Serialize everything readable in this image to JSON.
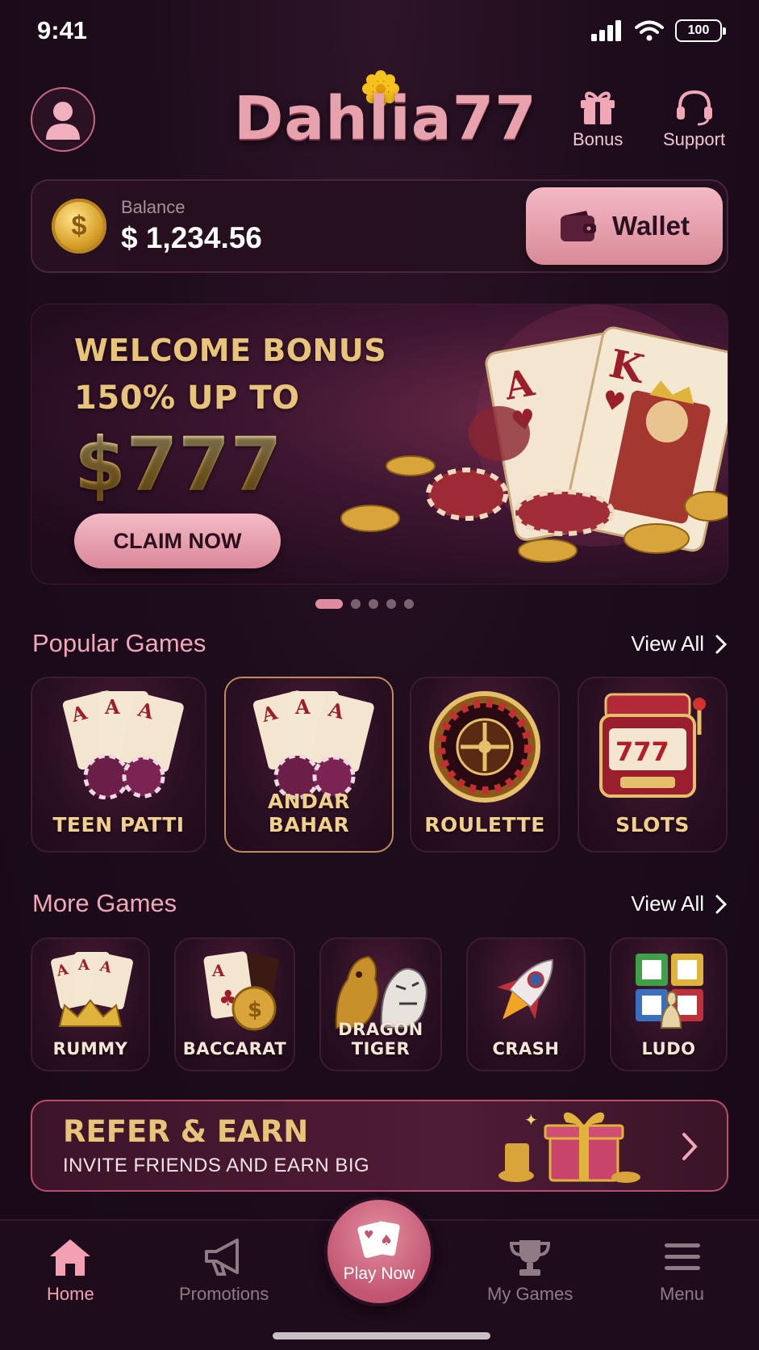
{
  "status": {
    "time": "9:41",
    "battery": "100"
  },
  "header": {
    "brand": "Dahlia77",
    "bonus_label": "Bonus",
    "support_label": "Support"
  },
  "balance": {
    "label": "Balance",
    "value": "$ 1,234.56",
    "wallet_label": "Wallet"
  },
  "banner": {
    "line1": "WELCOME BONUS",
    "line2": "150% UP TO",
    "amount": "$777",
    "cta": "CLAIM NOW",
    "slide_count": 5,
    "active_slide": 1
  },
  "popular": {
    "title": "Popular Games",
    "view_all": "View All",
    "games": [
      {
        "label": "TEEN PATTI",
        "icon": "cards-chips-icon"
      },
      {
        "label": "ANDAR BAHAR",
        "icon": "cards-chips-icon"
      },
      {
        "label": "ROULETTE",
        "icon": "roulette-wheel-icon"
      },
      {
        "label": "SLOTS",
        "icon": "slot-machine-icon"
      }
    ]
  },
  "more": {
    "title": "More Games",
    "view_all": "View All",
    "games": [
      {
        "label": "RUMMY",
        "icon": "cards-crown-icon"
      },
      {
        "label": "BACCARAT",
        "icon": "card-coin-icon"
      },
      {
        "label": "DRAGON TIGER",
        "icon": "dragon-tiger-icon"
      },
      {
        "label": "CRASH",
        "icon": "rocket-icon"
      },
      {
        "label": "LUDO",
        "icon": "ludo-board-icon"
      }
    ]
  },
  "refer": {
    "title": "REFER & EARN",
    "subtitle": "INVITE FRIENDS AND EARN BIG"
  },
  "nav": {
    "home": "Home",
    "promotions": "Promotions",
    "play_now": "Play Now",
    "my_games": "My Games",
    "menu": "Menu"
  },
  "colors": {
    "background": "#1d0c1c",
    "accent_pink": "#e08c9f",
    "gold": "#e8c47a"
  }
}
